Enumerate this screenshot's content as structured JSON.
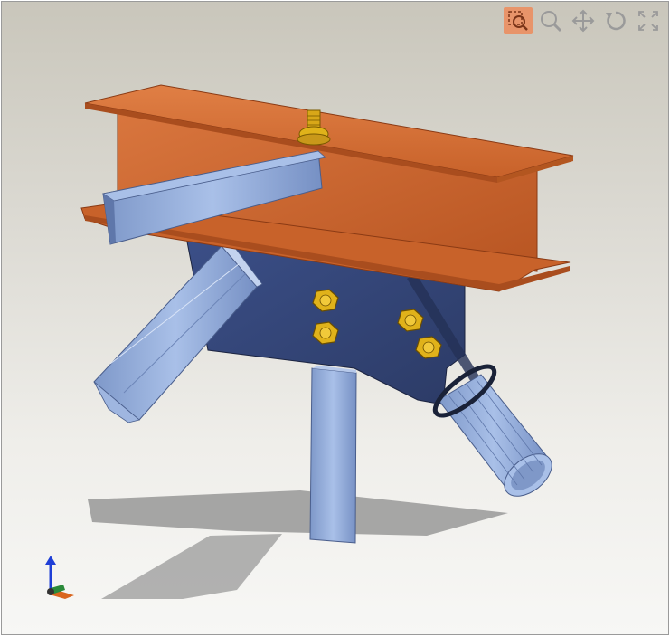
{
  "viewer": {
    "background": "#e6e4de",
    "toolbar": [
      {
        "name": "zoom-box",
        "icon": "zoom-window-icon",
        "active": true
      },
      {
        "name": "zoom",
        "icon": "magnifier-icon",
        "active": false
      },
      {
        "name": "pan",
        "icon": "pan-arrows-icon",
        "active": false
      },
      {
        "name": "rotate",
        "icon": "rotate-icon",
        "active": false
      },
      {
        "name": "fit",
        "icon": "fit-view-icon",
        "active": false
      }
    ],
    "accent": "#e8946a"
  },
  "model": {
    "beam_color": "#c8622a",
    "gusset_color": "#35477a",
    "member_color": "#8aa6d6",
    "bolt_color": "#e0b21a",
    "axis_colors": {
      "z": "#1f3fd6",
      "x": "#d9661f",
      "y": "#2a8a3a"
    }
  }
}
